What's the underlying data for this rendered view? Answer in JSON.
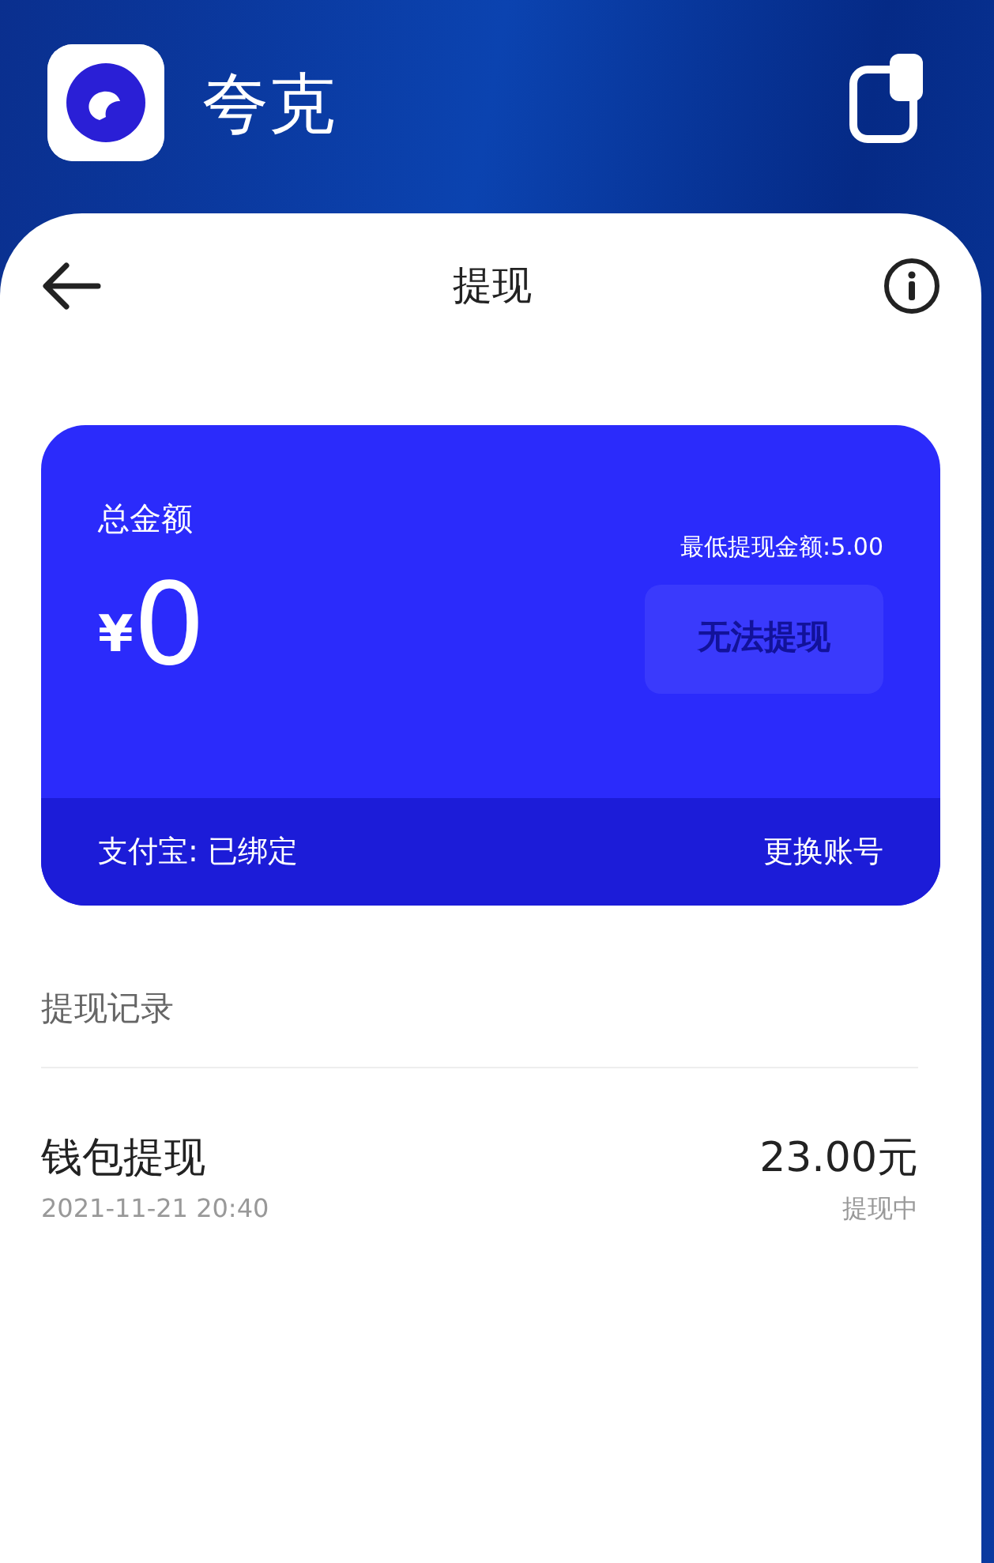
{
  "app": {
    "name": "夸克"
  },
  "nav": {
    "title": "提现"
  },
  "balance_card": {
    "label": "总金额",
    "currency": "¥",
    "amount": "0",
    "minimum": "最低提现金额:5.00",
    "withdraw_button": {
      "label": "无法提现",
      "disabled": true
    },
    "account": "支付宝: 已绑定",
    "change_account": "更换账号"
  },
  "records": {
    "heading": "提现记录",
    "items": [
      {
        "title": "钱包提现",
        "time": "2021-11-21 20:40",
        "amount": "23.00元",
        "status": "提现中"
      }
    ]
  }
}
